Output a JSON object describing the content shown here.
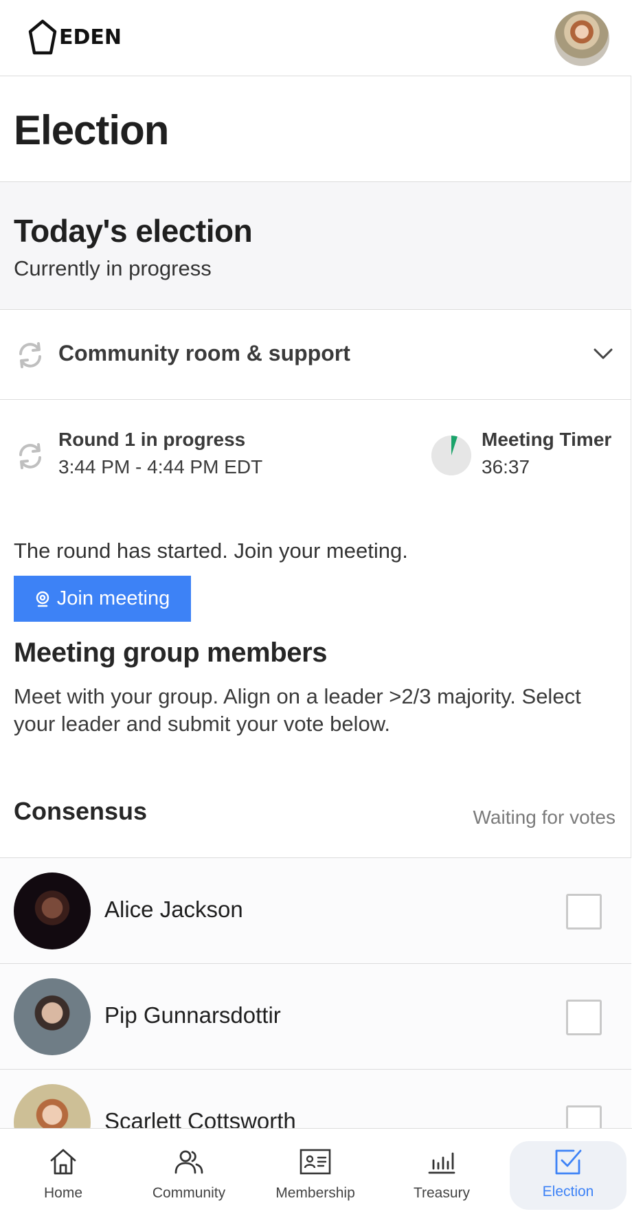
{
  "header": {
    "logo_text": "EDEN",
    "avatar_alt": "user-avatar"
  },
  "page": {
    "title": "Election"
  },
  "today": {
    "title": "Today's election",
    "status": "Currently in progress"
  },
  "room": {
    "label": "Community room & support"
  },
  "round": {
    "title": "Round 1 in progress",
    "time": "3:44 PM - 4:44 PM EDT",
    "timer_label": "Meeting Timer",
    "timer_value": "36:37",
    "timer_progress_fraction": 0.05
  },
  "meeting": {
    "started_text": "The round has started. Join your meeting.",
    "join_label": "Join meeting"
  },
  "group": {
    "title": "Meeting group members",
    "description": "Meet with your group. Align on a leader >2/3 majority. Select your leader and submit your vote below."
  },
  "consensus": {
    "title": "Consensus",
    "status": "Waiting for votes"
  },
  "members": [
    {
      "name": "Alice Jackson",
      "checked": false
    },
    {
      "name": "Pip Gunnarsdottir",
      "checked": false
    },
    {
      "name": "Scarlett Cottsworth",
      "checked": false
    }
  ],
  "nav": {
    "items": [
      {
        "label": "Home",
        "icon": "home-icon"
      },
      {
        "label": "Community",
        "icon": "community-icon"
      },
      {
        "label": "Membership",
        "icon": "membership-icon"
      },
      {
        "label": "Treasury",
        "icon": "treasury-icon"
      },
      {
        "label": "Election",
        "icon": "election-icon",
        "active": true
      }
    ]
  },
  "colors": {
    "accent": "#3d82f6",
    "timer_green": "#1aa36a"
  }
}
